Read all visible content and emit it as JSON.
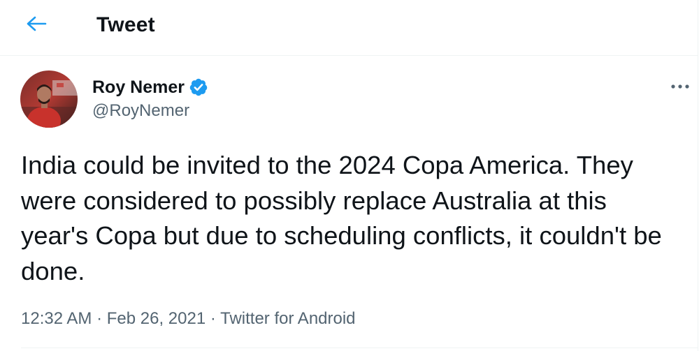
{
  "header": {
    "back_icon": "arrow-left-icon",
    "title": "Tweet"
  },
  "tweet": {
    "author": {
      "name": "Roy Nemer",
      "handle": "@RoyNemer",
      "verified": true,
      "verified_icon": "verified-badge-icon",
      "avatar": "avatar-photo"
    },
    "more_icon": "more-options-icon",
    "text": "India could be invited to the 2024 Copa America. They\nwere considered to possibly replace Australia at this\nyear's Copa but due to scheduling conflicts, it couldn't be\ndone.",
    "time": "12:32 AM",
    "date": "Feb 26, 2021",
    "source": "Twitter for Android",
    "separator": "·"
  },
  "colors": {
    "accent": "#1d9bf0",
    "text_primary": "#0f1419",
    "text_secondary": "#536471",
    "divider": "#eff3f4",
    "background": "#ffffff"
  }
}
